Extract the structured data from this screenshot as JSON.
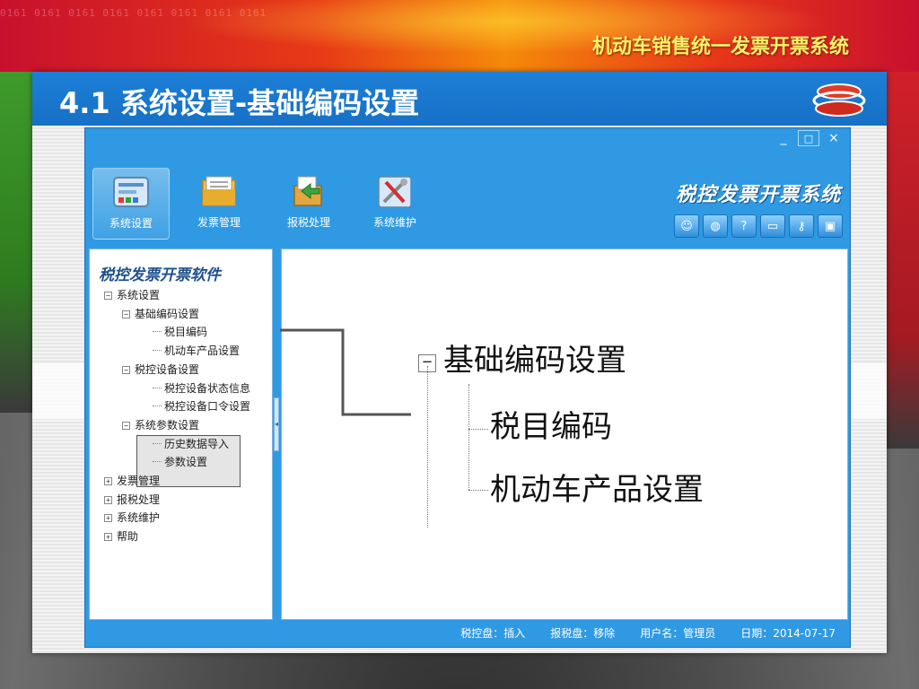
{
  "slide": {
    "app_title": "机动车销售统一发票开票系统",
    "heading": "4.1 系统设置-基础编码设置",
    "banner_digits": "0161 0161 0161 0161 0161 0161 0161 0161"
  },
  "window": {
    "controls": [
      "_",
      "□",
      "×"
    ],
    "brand": "税控发票开票系统",
    "toolbar": [
      {
        "label": "系统设置",
        "icon": "settings-panel-icon",
        "active": true
      },
      {
        "label": "发票管理",
        "icon": "folder-icon",
        "active": false
      },
      {
        "label": "报税处理",
        "icon": "tax-report-icon",
        "active": false
      },
      {
        "label": "系统维护",
        "icon": "tools-icon",
        "active": false
      }
    ],
    "quick_icons": [
      "user-icon",
      "globe-icon",
      "help-icon",
      "window-icon",
      "key-icon",
      "lock-icon"
    ]
  },
  "sidebar": {
    "title": "税控发票开票软件",
    "tree": [
      {
        "label": "系统设置",
        "level": 0,
        "expander": "−"
      },
      {
        "label": "基础编码设置",
        "level": 1,
        "expander": "−"
      },
      {
        "label": "税目编码",
        "level": 2,
        "expander": ""
      },
      {
        "label": "机动车产品设置",
        "level": 2,
        "expander": ""
      },
      {
        "label": "税控设备设置",
        "level": 1,
        "expander": "−"
      },
      {
        "label": "税控设备状态信息",
        "level": 2,
        "expander": ""
      },
      {
        "label": "税控设备口令设置",
        "level": 2,
        "expander": ""
      },
      {
        "label": "系统参数设置",
        "level": 1,
        "expander": "−"
      },
      {
        "label": "历史数据导入",
        "level": 2,
        "expander": ""
      },
      {
        "label": "参数设置",
        "level": 2,
        "expander": ""
      },
      {
        "label": "发票管理",
        "level": 0,
        "expander": "+"
      },
      {
        "label": "报税处理",
        "level": 0,
        "expander": "+"
      },
      {
        "label": "系统维护",
        "level": 0,
        "expander": "+"
      },
      {
        "label": "帮助",
        "level": 0,
        "expander": "+"
      }
    ]
  },
  "zoom": {
    "root": "基础编码设置",
    "root_expander": "−",
    "children": [
      "税目编码",
      "机动车产品设置"
    ]
  },
  "status": {
    "tax_disk": "税控盘：插入",
    "report_disk": "报税盘：移除",
    "user": "用户名：管理员",
    "date": "日期：2014-07-17"
  },
  "colors": {
    "window_blue": "#2f9ae3",
    "header_blue": "#1d7fd6",
    "title_yellow": "#fff46a",
    "sidebar_title": "#1f4f8e"
  }
}
